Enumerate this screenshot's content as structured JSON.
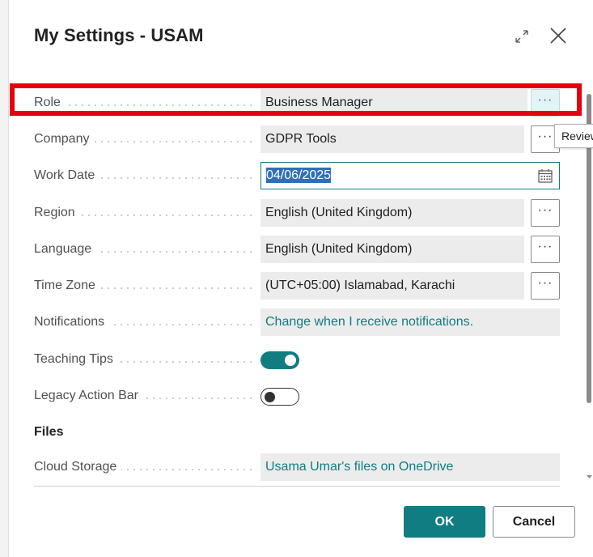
{
  "dialog": {
    "title": "My Settings - USAM"
  },
  "fields": {
    "role": {
      "label": "Role",
      "value": "Business Manager",
      "more": "···"
    },
    "company": {
      "label": "Company",
      "value": "GDPR Tools",
      "more": "···"
    },
    "work_date": {
      "label": "Work Date",
      "value": "04/06/2025"
    },
    "region": {
      "label": "Region",
      "value": "English (United Kingdom)",
      "more": "···"
    },
    "language": {
      "label": "Language",
      "value": "English (United Kingdom)",
      "more": "···"
    },
    "time_zone": {
      "label": "Time Zone",
      "value": "(UTC+05:00) Islamabad, Karachi",
      "more": "···"
    },
    "notifications": {
      "label": "Notifications",
      "value": "Change when I receive notifications."
    },
    "teaching_tips": {
      "label": "Teaching Tips",
      "state": "on"
    },
    "legacy_action_bar": {
      "label": "Legacy Action Bar",
      "state": "off"
    }
  },
  "files": {
    "heading": "Files",
    "cloud_storage": {
      "label": "Cloud Storage",
      "value": "Usama Umar's files on OneDrive"
    }
  },
  "tooltip": {
    "text": "Review"
  },
  "buttons": {
    "ok": "OK",
    "cancel": "Cancel"
  },
  "colors": {
    "accent": "#0f7d82",
    "highlight": "#e3000f",
    "selection": "#2f6fb8"
  },
  "icons": {
    "expand": "expand-icon",
    "close": "close-icon",
    "calendar": "calendar-icon"
  }
}
